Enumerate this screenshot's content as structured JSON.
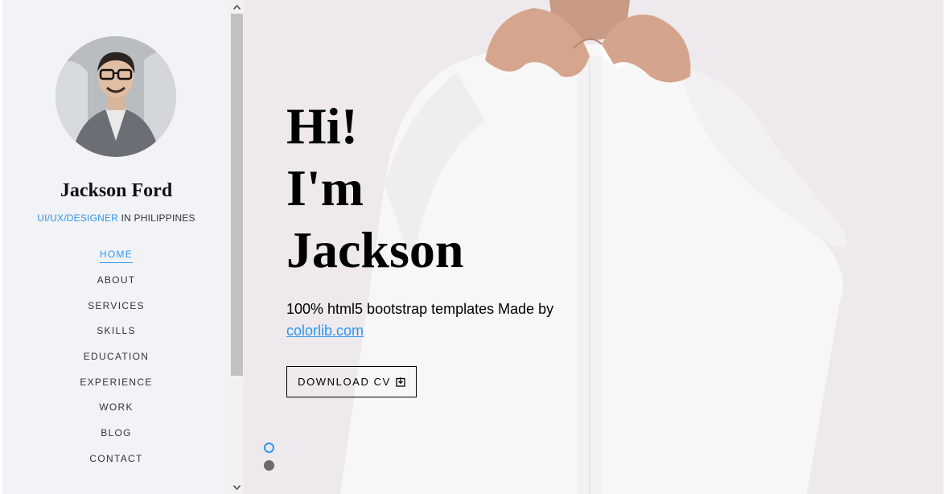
{
  "profile": {
    "name": "Jackson Ford",
    "role_accent": "UI/UX/DESIGNER",
    "role_rest": " IN PHILIPPINES"
  },
  "nav": {
    "items": [
      {
        "label": "HOME",
        "active": true
      },
      {
        "label": "ABOUT"
      },
      {
        "label": "SERVICES"
      },
      {
        "label": "SKILLS"
      },
      {
        "label": "EDUCATION"
      },
      {
        "label": "EXPERIENCE"
      },
      {
        "label": "WORK"
      },
      {
        "label": "BLOG"
      },
      {
        "label": "CONTACT"
      }
    ]
  },
  "hero": {
    "line1": "Hi!",
    "line2": "I'm",
    "line3": "Jackson",
    "sub_text": "100% html5 bootstrap templates Made by ",
    "sub_link": "colorlib.com",
    "button_label": "DOWNLOAD CV",
    "button_icon": "download-icon"
  },
  "scrollbar": {
    "up_icon": "chevron-up-icon",
    "down_icon": "chevron-down-icon"
  },
  "slider": {
    "active_index": 0
  },
  "colors": {
    "accent": "#2c98f0",
    "sidebar_bg": "#f2f3f7",
    "hero_bg": "#ede9ec"
  }
}
